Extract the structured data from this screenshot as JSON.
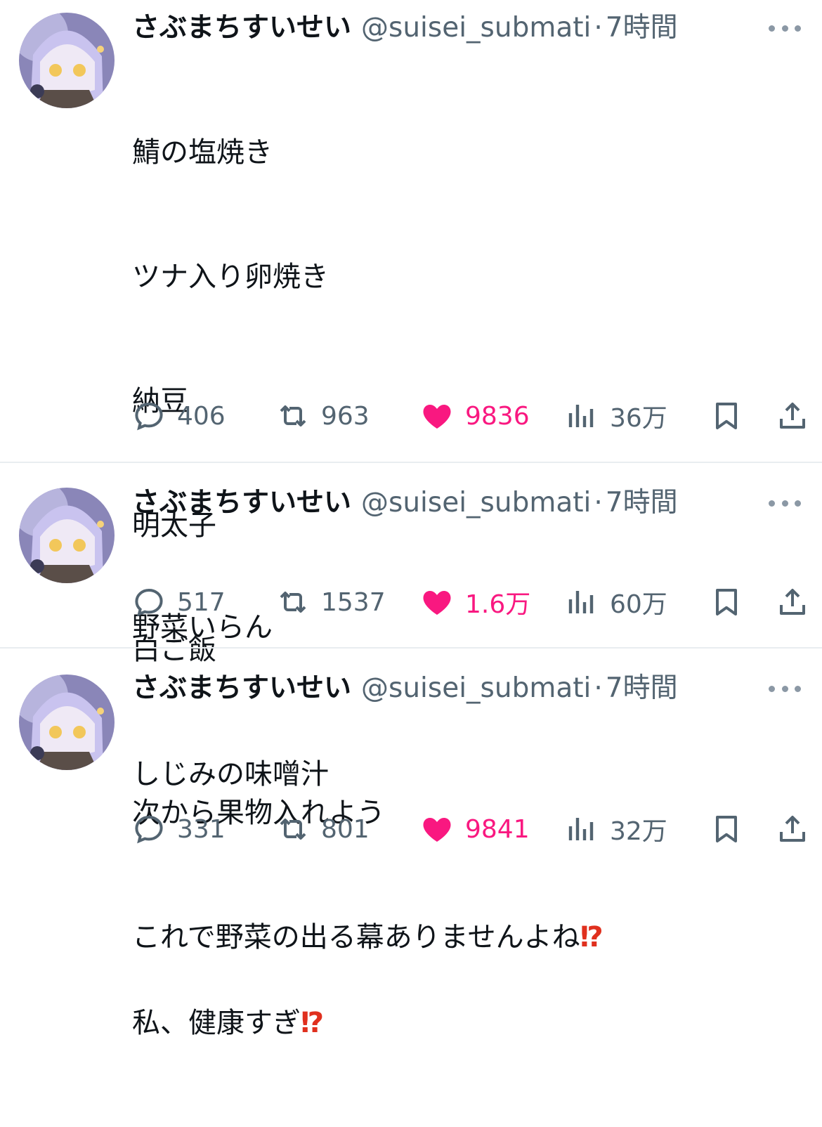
{
  "tweets": [
    {
      "name": "さぶまちすいせい",
      "handle": "@suisei_submati",
      "separator": "·",
      "time": "7時間",
      "lines": [
        "鯖の塩焼き",
        "ツナ入り卵焼き",
        "納豆",
        "明太子",
        "白ご飯",
        "しじみの味噌汁",
        "",
        "私、健康すぎ"
      ],
      "last_line_emoji": "⁉",
      "replies": "406",
      "retweets": "963",
      "likes": "9836",
      "views": "36万"
    },
    {
      "name": "さぶまちすいせい",
      "handle": "@suisei_submati",
      "separator": "·",
      "time": "7時間",
      "lines": [
        "野菜いらん"
      ],
      "replies": "517",
      "retweets": "1537",
      "likes": "1.6万",
      "views": "60万"
    },
    {
      "name": "さぶまちすいせい",
      "handle": "@suisei_submati",
      "separator": "·",
      "time": "7時間",
      "lines": [
        "次から果物入れよう",
        "これで野菜の出る幕ありませんよね"
      ],
      "last_line_emoji": "⁉",
      "replies": "331",
      "retweets": "801",
      "likes": "9841",
      "views": "32万"
    }
  ],
  "colors": {
    "text": "#0f1419",
    "secondary": "#536471",
    "like": "#f91880",
    "emoji": "#e0301e",
    "divider": "#e9edf0"
  },
  "icons": [
    "avatar",
    "more-icon",
    "reply-icon",
    "retweet-icon",
    "like-heart-icon",
    "views-icon",
    "bookmark-icon",
    "share-icon"
  ]
}
